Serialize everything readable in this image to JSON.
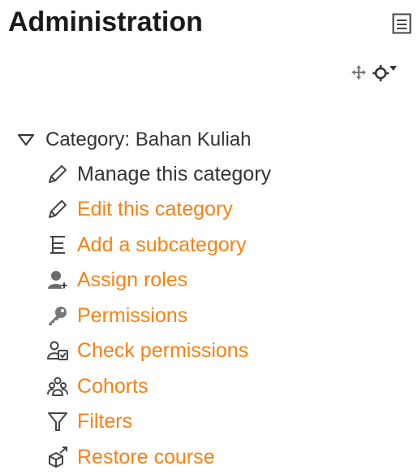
{
  "block": {
    "title": "Administration"
  },
  "icons": {
    "dock": "dock-block-icon",
    "move": "move-icon",
    "actions": "gear-menu-icon"
  },
  "colors": {
    "link": "#f98012",
    "text": "#333333",
    "icon": "#5a5a5a"
  },
  "tree": {
    "root_label": "Category: Bahan Kuliah",
    "items": [
      {
        "label": "Manage this category",
        "icon": "pencil-icon",
        "is_link": false
      },
      {
        "label": "Edit this category",
        "icon": "pencil-icon",
        "is_link": true
      },
      {
        "label": "Add a subcategory",
        "icon": "subcategory-icon",
        "is_link": true
      },
      {
        "label": "Assign roles",
        "icon": "assign-roles-icon",
        "is_link": true
      },
      {
        "label": "Permissions",
        "icon": "key-icon",
        "is_link": true
      },
      {
        "label": "Check permissions",
        "icon": "check-permissions-icon",
        "is_link": true
      },
      {
        "label": "Cohorts",
        "icon": "cohorts-icon",
        "is_link": true
      },
      {
        "label": "Filters",
        "icon": "filter-icon",
        "is_link": true
      },
      {
        "label": "Restore course",
        "icon": "restore-icon",
        "is_link": true
      }
    ]
  }
}
